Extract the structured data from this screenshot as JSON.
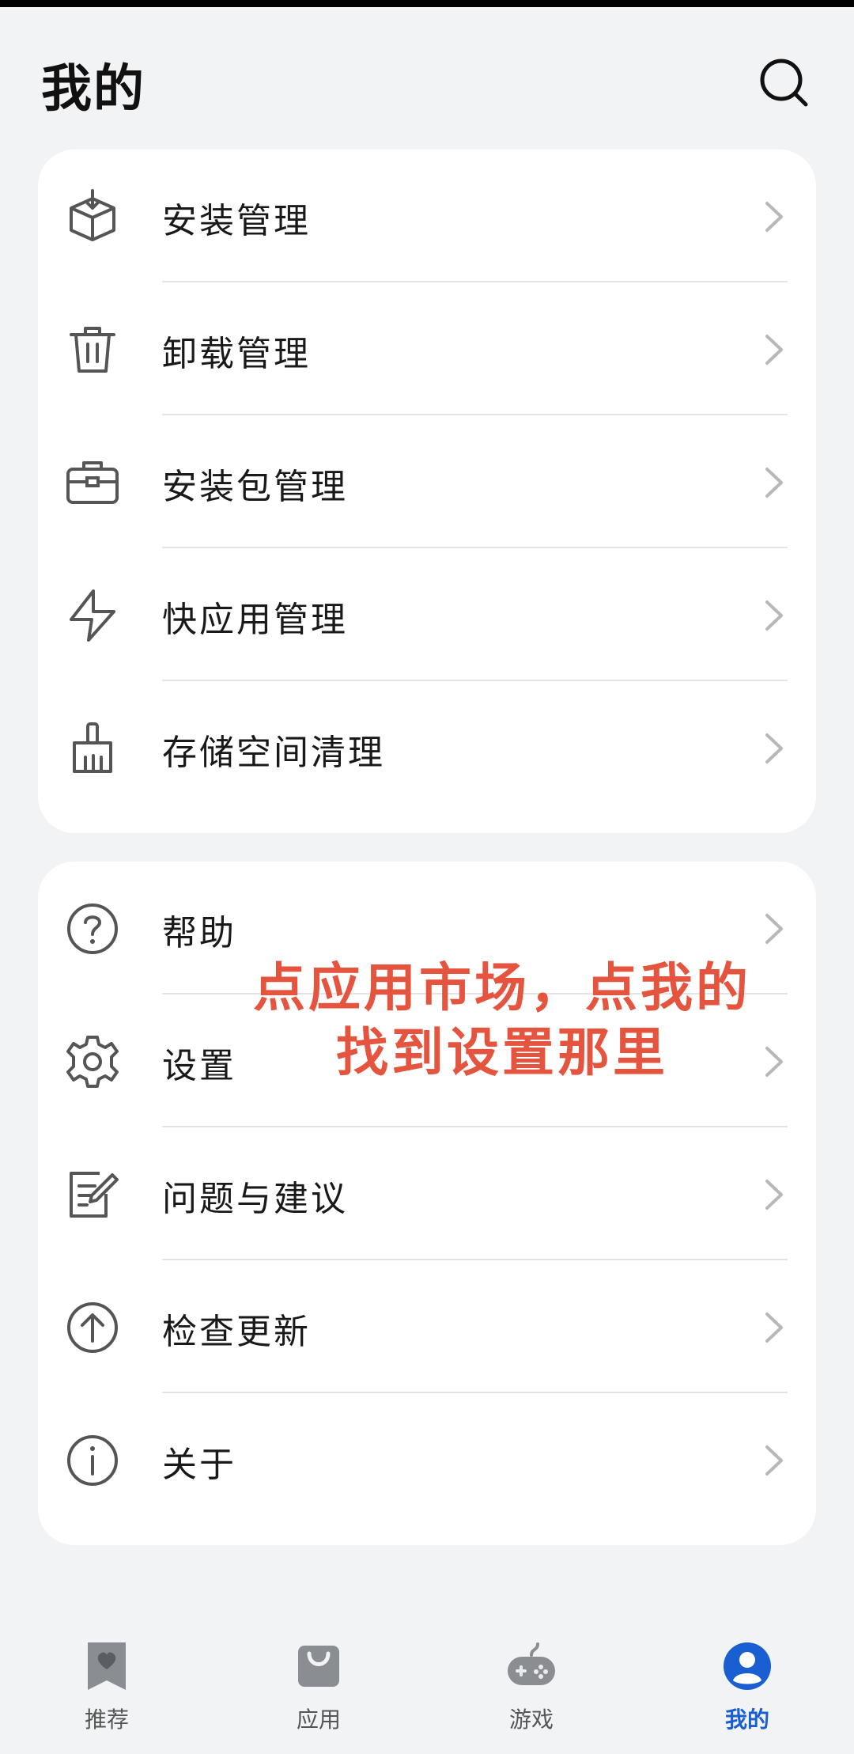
{
  "header": {
    "title": "我的",
    "search_icon": "search-icon"
  },
  "menu_group_1": [
    {
      "label": "安装管理",
      "icon": "install-box-icon"
    },
    {
      "label": "卸载管理",
      "icon": "trash-icon"
    },
    {
      "label": "安装包管理",
      "icon": "briefcase-icon"
    },
    {
      "label": "快应用管理",
      "icon": "lightning-icon"
    },
    {
      "label": "存储空间清理",
      "icon": "broom-icon"
    }
  ],
  "menu_group_2": [
    {
      "label": "帮助",
      "icon": "help-icon"
    },
    {
      "label": "设置",
      "icon": "gear-icon"
    },
    {
      "label": "问题与建议",
      "icon": "feedback-icon"
    },
    {
      "label": "检查更新",
      "icon": "update-arrow-icon"
    },
    {
      "label": "关于",
      "icon": "info-icon"
    }
  ],
  "overlay": {
    "line1": "点应用市场，点我的",
    "line2": "找到设置那里"
  },
  "tabs": [
    {
      "label": "推荐",
      "icon": "heart-bookmark-icon",
      "active": false
    },
    {
      "label": "应用",
      "icon": "shopping-bag-icon",
      "active": false
    },
    {
      "label": "游戏",
      "icon": "gamepad-icon",
      "active": false
    },
    {
      "label": "我的",
      "icon": "profile-icon",
      "active": true
    }
  ],
  "colors": {
    "accent": "#1a5fd1",
    "overlay_text": "#e5543e",
    "background": "#f1f3f5",
    "card": "#ffffff"
  }
}
